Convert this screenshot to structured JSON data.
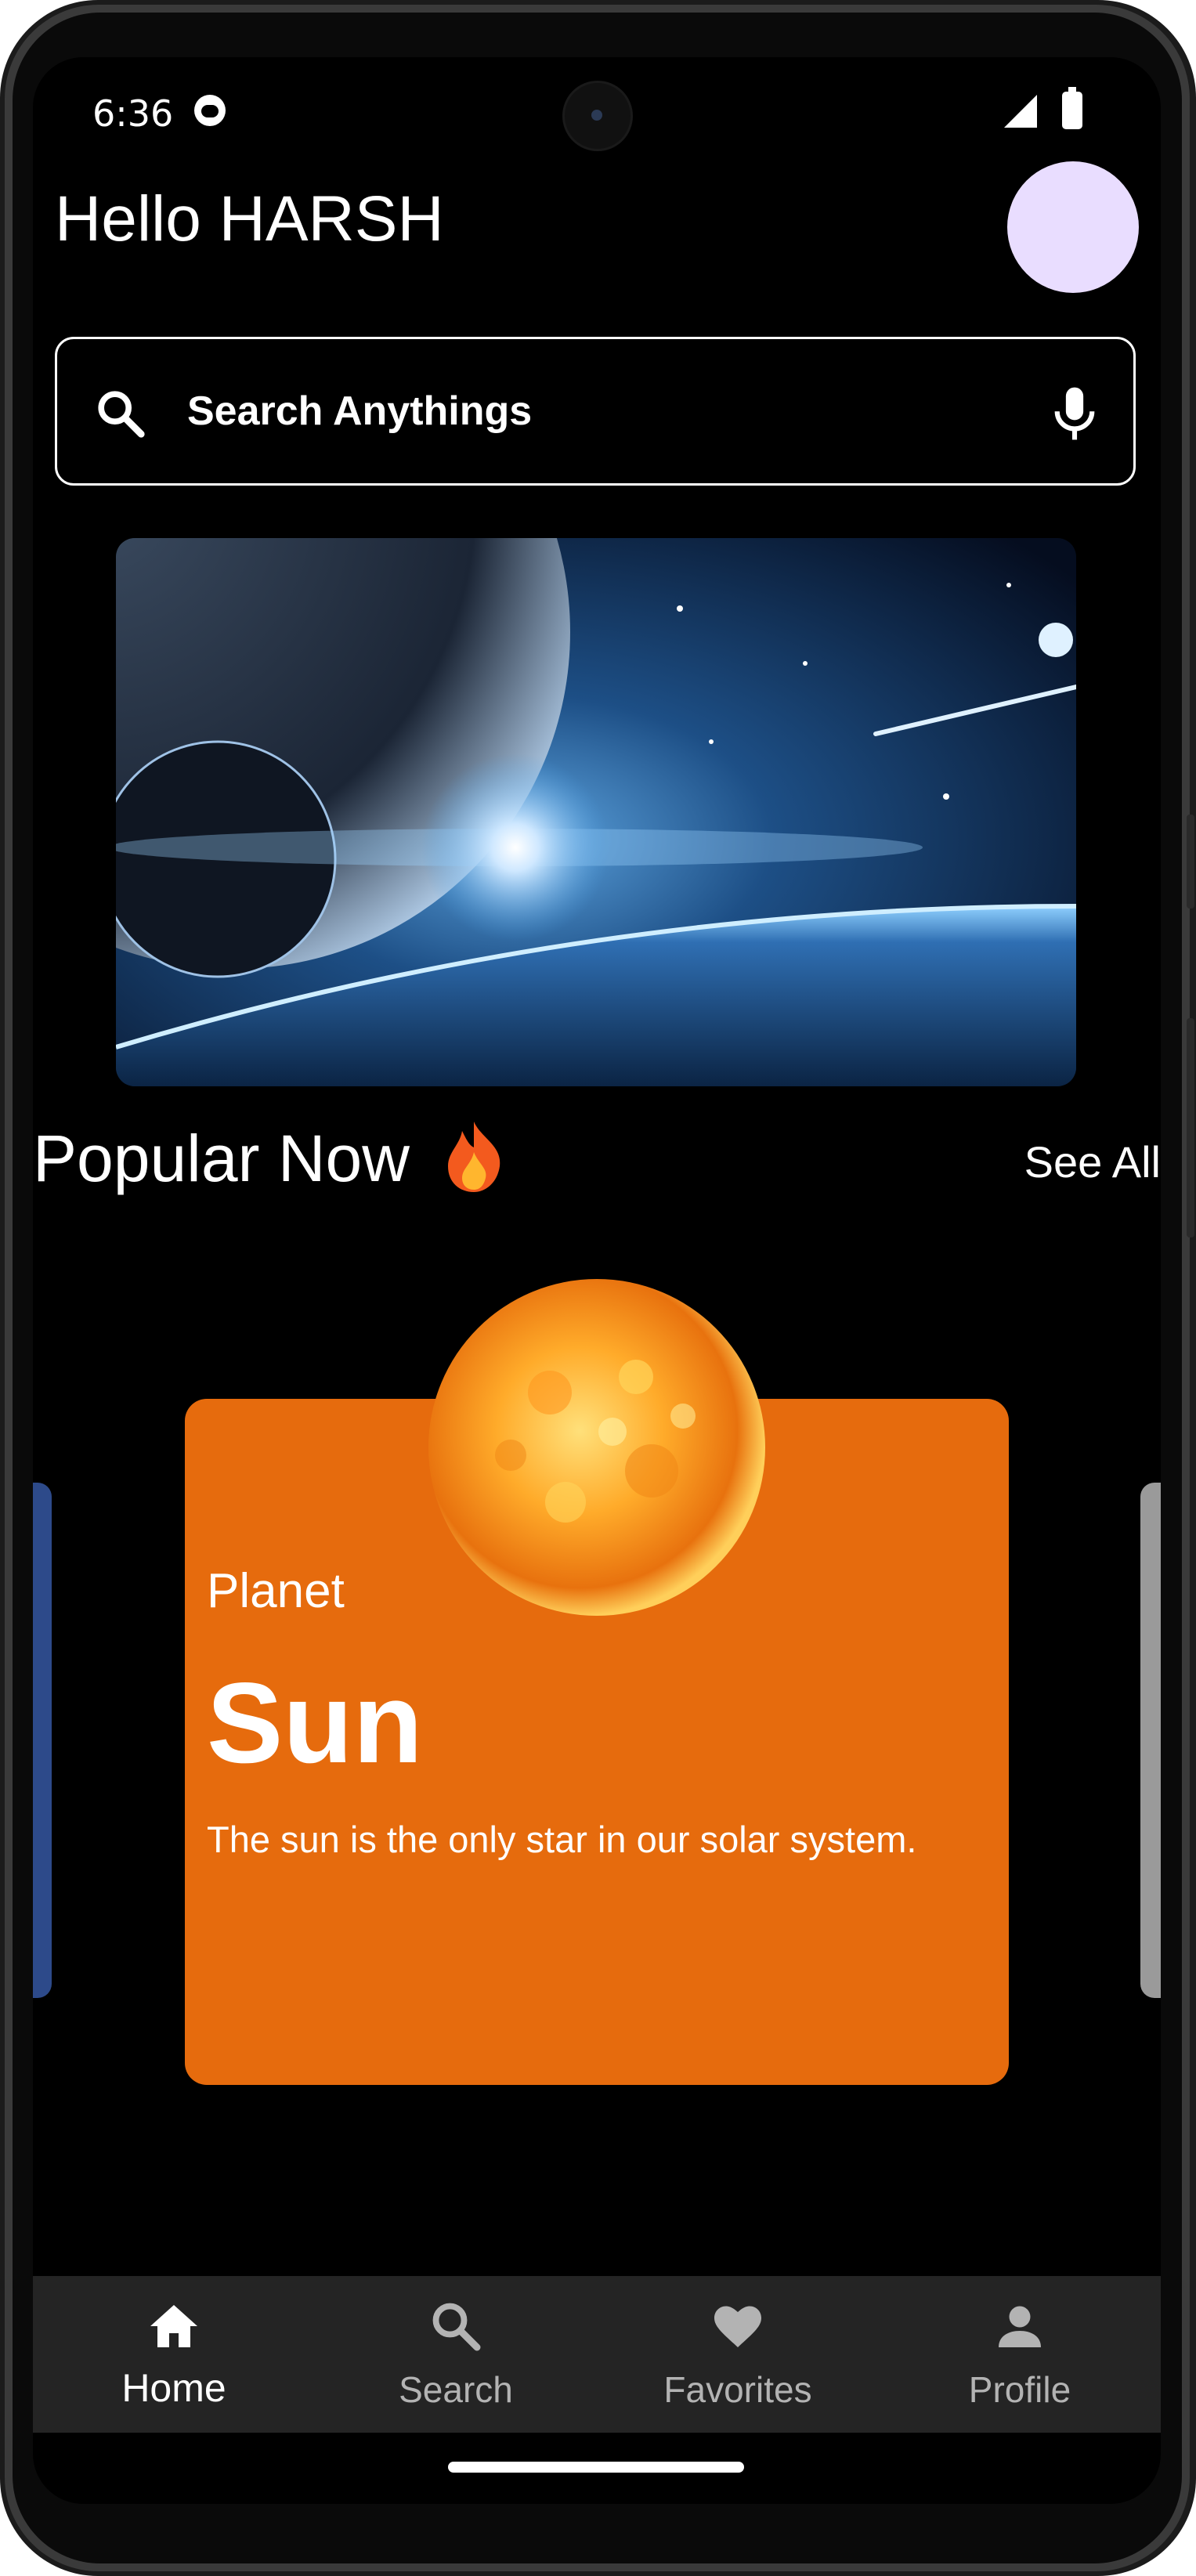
{
  "status_bar": {
    "time": "6:36"
  },
  "header": {
    "greeting": "Hello HARSH"
  },
  "search": {
    "placeholder": "Search Anythings"
  },
  "popular": {
    "title": "Popular Now",
    "see_all": "See All"
  },
  "card": {
    "category": "Planet",
    "name": "Sun",
    "description": "The sun is the only star in our solar system.",
    "color": "#e66b0d"
  },
  "bottom_nav": {
    "items": [
      {
        "label": "Home",
        "icon": "home-icon",
        "active": true
      },
      {
        "label": "Search",
        "icon": "search-icon",
        "active": false
      },
      {
        "label": "Favorites",
        "icon": "heart-icon",
        "active": false
      },
      {
        "label": "Profile",
        "icon": "person-icon",
        "active": false
      }
    ]
  },
  "colors": {
    "background": "#000000",
    "avatar": "#e9ddff",
    "nav_background": "#242424",
    "nav_inactive": "#b3b3b3"
  }
}
